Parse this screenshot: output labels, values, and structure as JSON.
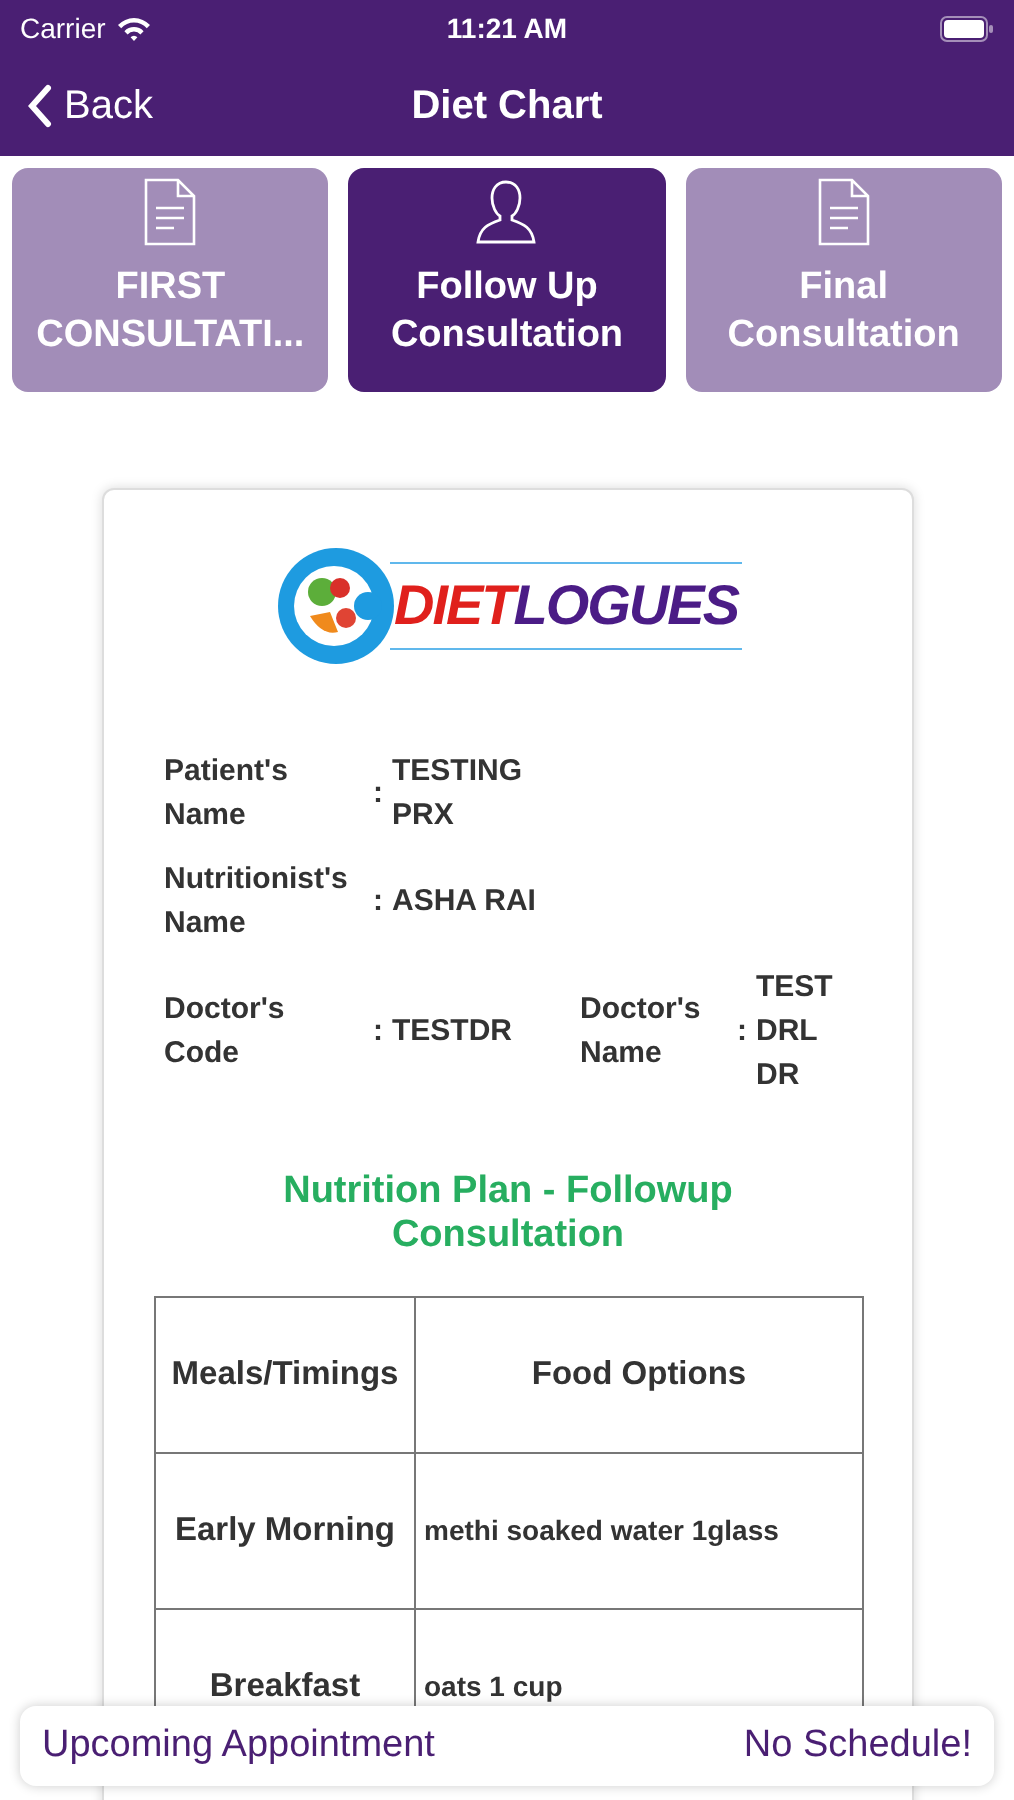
{
  "status_bar": {
    "carrier": "Carrier",
    "time": "11:21 AM"
  },
  "nav": {
    "back": "Back",
    "title": "Diet Chart"
  },
  "tabs": [
    {
      "label": "FIRST CONSULTATI...",
      "kind": "document",
      "selected": false
    },
    {
      "label": "Follow Up Consultation",
      "kind": "person",
      "selected": true
    },
    {
      "label": "Final Consultation",
      "kind": "document",
      "selected": false
    }
  ],
  "logo": {
    "parts": [
      {
        "text": "DIET",
        "color": "#e0201c"
      },
      {
        "text": "LOGUES",
        "color": "#4b1c86"
      }
    ]
  },
  "info": [
    {
      "label": "Patient's Name",
      "separator": ":",
      "value": "TESTING PRX"
    },
    {
      "label": "Nutritionist's Name",
      "separator": ":",
      "value": "ASHA RAI"
    },
    {
      "label": "Doctor's Code",
      "separator": ":",
      "value": "TESTDR",
      "label_2": "Doctor's Name",
      "separator_2": ":",
      "value_2": "TEST DRL DR"
    }
  ],
  "plan_title": "Nutrition Plan - Followup Consultation",
  "table": {
    "columns": [
      "Meals/Timings",
      "Food Options"
    ],
    "rows": [
      [
        "Early Morning",
        "methi soaked water 1glass"
      ],
      [
        "Breakfast",
        "oats 1 cup"
      ]
    ]
  },
  "appointment_bar": {
    "label": "Upcoming Appointment",
    "value": "No Schedule!"
  }
}
